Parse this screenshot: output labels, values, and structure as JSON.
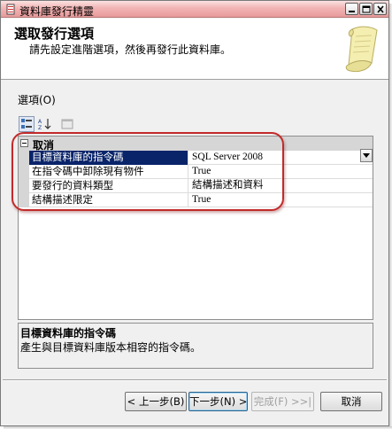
{
  "window": {
    "title": "資料庫發行精靈"
  },
  "header": {
    "title": "選取發行選項",
    "subtitle": "請先設定進階選項，然後再發行此資料庫。"
  },
  "options": {
    "label": "選項(O)"
  },
  "toolbar": {
    "icons": [
      "categorized-icon",
      "alphabetical-icon",
      "property-pages-icon"
    ]
  },
  "grid": {
    "category": "取消",
    "rows": [
      {
        "name": "目標資料庫的指令碼",
        "value": "SQL Server 2008"
      },
      {
        "name": "在指令碼中卸除現有物件",
        "value": "True"
      },
      {
        "name": "要發行的資料類型",
        "value": "結構描述和資料"
      },
      {
        "name": "結構描述限定",
        "value": "True"
      }
    ]
  },
  "description": {
    "title": "目標資料庫的指令碼",
    "text": "產生與目標資料庫版本相容的指令碼。"
  },
  "buttons": {
    "back": "< 上一步(B)",
    "next": "下一步(N) >",
    "finish": "完成(F) >>|",
    "cancel": "取消"
  },
  "colors": {
    "title_bar": "#f2b4b4",
    "selection": "#0a246a",
    "annotation_circle": "#c22a2a"
  }
}
